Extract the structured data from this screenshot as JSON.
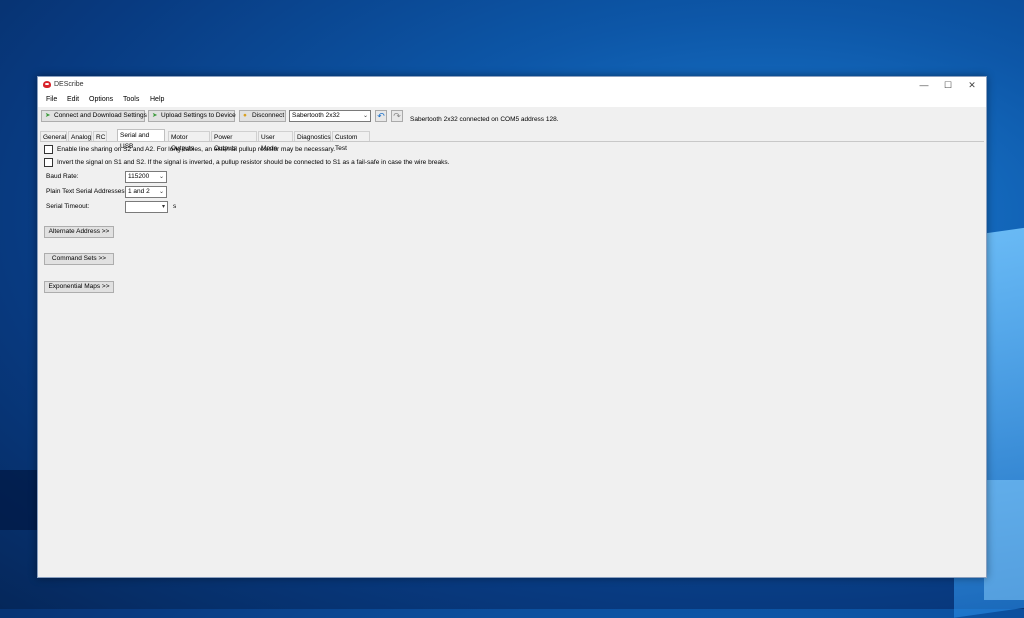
{
  "window": {
    "title": "DEScribe"
  },
  "menu": [
    "File",
    "Edit",
    "Options",
    "Tools",
    "Help"
  ],
  "toolbar": {
    "connect_label": "Connect and Download Settings",
    "upload_label": "Upload Settings to Device",
    "disconnect_label": "Disconnect",
    "device_select": "Sabertooth 2x32",
    "status": "Sabertooth 2x32 connected on COM5 address 128."
  },
  "tabs": [
    "General",
    "Analog",
    "RC",
    "Serial and USB",
    "Motor Outputs",
    "Power Outputs",
    "User Mode",
    "Diagnostics",
    "Custom Test"
  ],
  "active_tab": "Serial and USB",
  "content": {
    "checkbox_line_sharing": "Enable line sharing on S2 and A2. For long cables, an external pullup resistor may be necessary.",
    "checkbox_invert": "Invert the signal on S1 and S2. If the signal is inverted, a pullup resistor should be connected to S1 as a fail-safe in case the wire breaks.",
    "baud_rate_label": "Baud Rate:",
    "baud_rate_value": "115200",
    "plain_text_label": "Plain Text Serial Addresses:",
    "plain_text_value": "1 and 2",
    "serial_timeout_label": "Serial Timeout:",
    "serial_timeout_value": "",
    "serial_timeout_unit": "s",
    "alternate_address_button": "Alternate Address >>",
    "command_sets_button": "Command Sets >>",
    "exponential_maps_button": "Exponential Maps >>"
  }
}
